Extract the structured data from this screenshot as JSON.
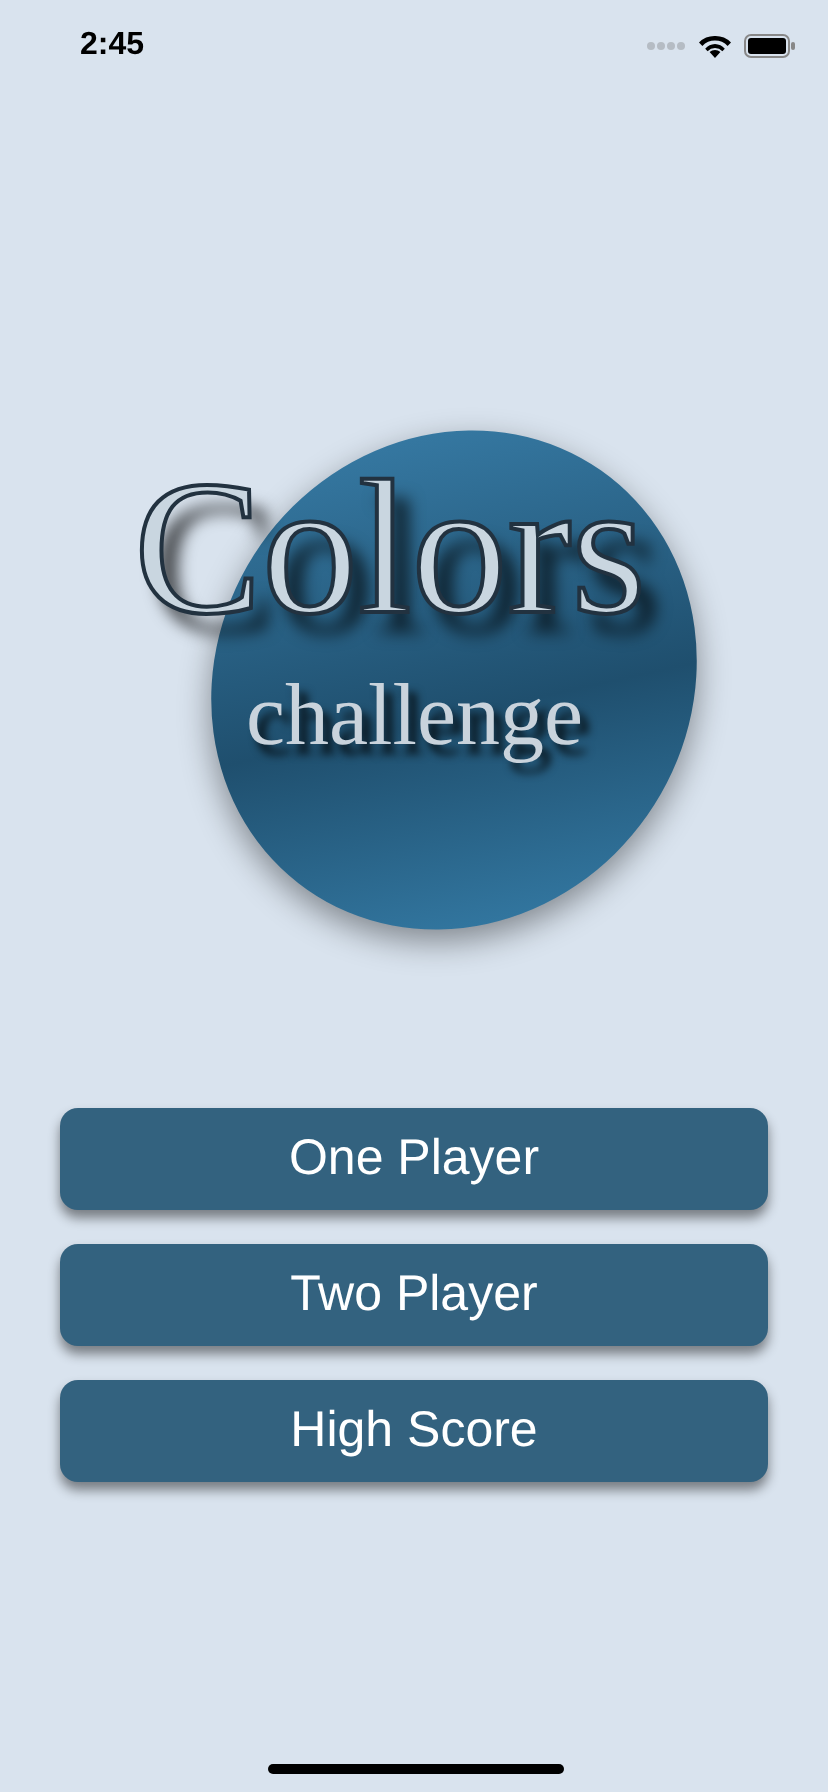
{
  "status_bar": {
    "time": "2:45"
  },
  "logo": {
    "title": "Colors",
    "subtitle": "challenge"
  },
  "buttons": [
    {
      "label": "One Player"
    },
    {
      "label": "Two Player"
    },
    {
      "label": "High Score"
    }
  ]
}
